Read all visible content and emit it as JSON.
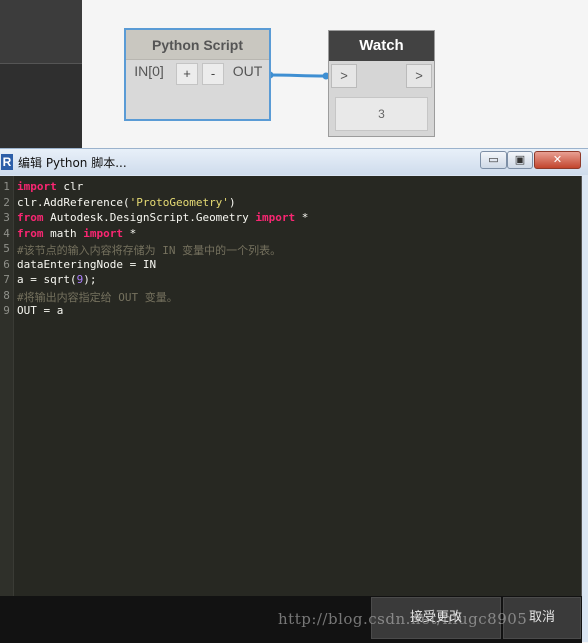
{
  "python_node": {
    "title": "Python Script",
    "input_port": "IN[0]",
    "add_button": "+",
    "remove_button": "-",
    "output_port": "OUT"
  },
  "watch_node": {
    "title": "Watch",
    "input_port": ">",
    "output_port": ">",
    "value": "3"
  },
  "window": {
    "icon": "R",
    "title": "编辑 Python 脚本...",
    "minimize": "▭",
    "maximize": "▣",
    "close": "✕"
  },
  "editor": {
    "line_numbers": [
      "1",
      "2",
      "3",
      "4",
      "5",
      "6",
      "7",
      "8",
      "9"
    ],
    "lines": [
      "import clr",
      "clr.AddReference('ProtoGeometry')",
      "from Autodesk.DesignScript.Geometry import *",
      "from math import *",
      "#该节点的输入内容将存储为 IN 变量中的一个列表。",
      "dataEnteringNode = IN",
      "a = sqrt(9);",
      "#将输出内容指定给 OUT 变量。",
      "OUT = a"
    ]
  },
  "footer": {
    "accept_label": "接受更改",
    "cancel_label": "取消"
  },
  "watermark": "http://blog.csdn.net/niugc8905",
  "colors": {
    "editor_bg": "#272822",
    "keyword": "#f92672",
    "string": "#e6db74",
    "number": "#ae81ff",
    "comment": "#75715e",
    "wire": "#3f8fd2"
  }
}
